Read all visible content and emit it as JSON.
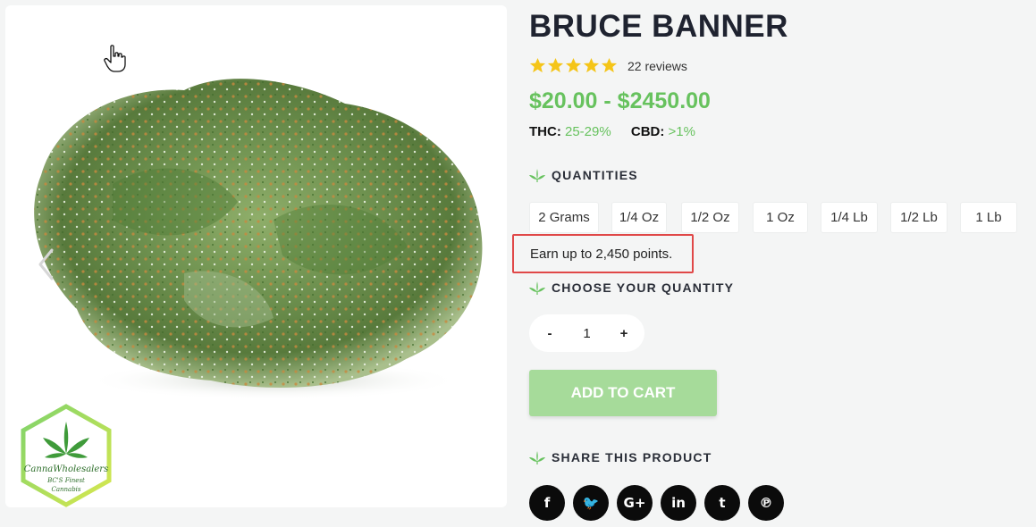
{
  "product": {
    "title": "BRUCE BANNER",
    "rating": 5,
    "reviews": "22 reviews",
    "price": "$20.00 - $2450.00",
    "thc_label": "THC:",
    "thc_value": "25-29%",
    "cbd_label": "CBD:",
    "cbd_value": ">1%"
  },
  "quantities": {
    "heading": "QUANTITIES",
    "options": [
      "2 Grams",
      "1/4 Oz",
      "1/2 Oz",
      "1 Oz",
      "1/4 Lb",
      "1/2 Lb",
      "1 Lb"
    ]
  },
  "points": {
    "text": "Earn up to 2,450 points."
  },
  "choose": {
    "heading": "CHOOSE YOUR QUANTITY",
    "minus": "-",
    "value": "1",
    "plus": "+"
  },
  "cart": {
    "label": "ADD TO CART"
  },
  "share": {
    "heading": "SHARE THIS PRODUCT",
    "icons": [
      "facebook-icon",
      "twitter-icon",
      "google-plus-icon",
      "linkedin-icon",
      "tumblr-icon",
      "pinterest-icon"
    ],
    "glyphs": [
      "f",
      "🐦",
      "G+",
      "in",
      "t",
      "℗"
    ]
  },
  "logo": {
    "line1": "CannaWholesalers",
    "line2": "BC'S Finest",
    "line3": "Cannabis"
  },
  "colors": {
    "accent_green": "#67c25e",
    "cart_button": "#a6db9a",
    "highlight_border": "#e04848",
    "star": "#f5c518"
  }
}
